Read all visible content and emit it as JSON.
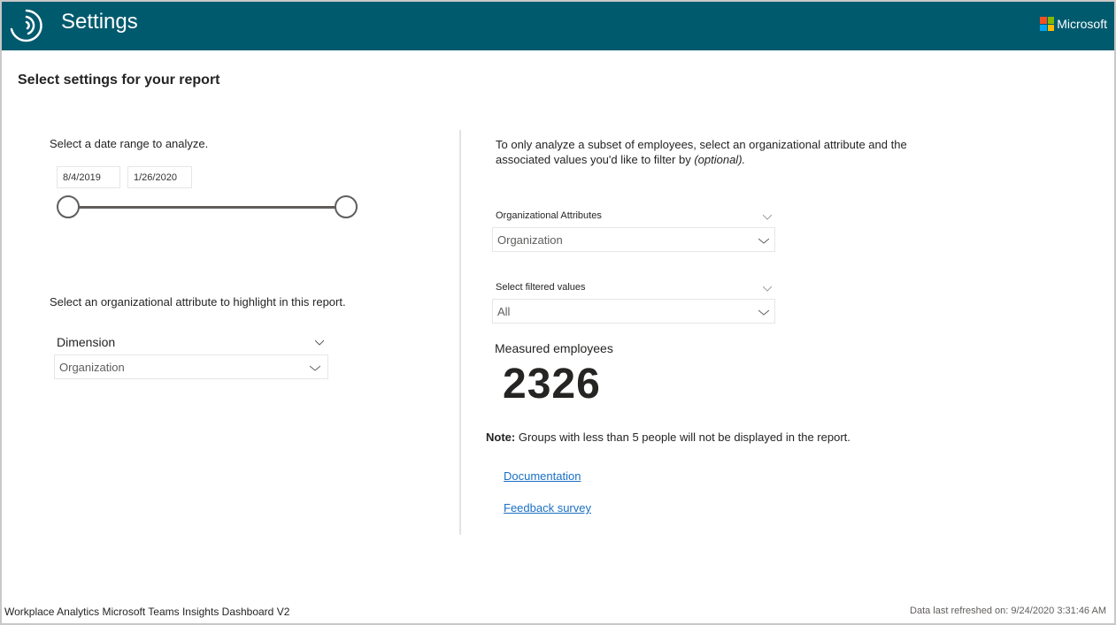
{
  "header": {
    "title": "Settings",
    "brand": "Microsoft",
    "brand_colors": [
      "#f25022",
      "#7fba00",
      "#00a4ef",
      "#ffb900"
    ],
    "background_color": "#005a6e"
  },
  "page": {
    "title": "Select settings for your report"
  },
  "left": {
    "date_range": {
      "label": "Select a date range to analyze.",
      "start": "8/4/2019",
      "end": "1/26/2020"
    },
    "highlight": {
      "label": "Select an organizational attribute to highlight in this report.",
      "dropdown_header": "Dimension",
      "selected": "Organization"
    }
  },
  "right": {
    "intro_text": "To only analyze a subset of employees, select an organizational attribute and the associated values you'd like to filter by ",
    "intro_italic": "(optional).",
    "org_attributes": {
      "header": "Organizational Attributes",
      "selected": "Organization"
    },
    "filtered_values": {
      "header": "Select filtered values",
      "selected": "All"
    },
    "kpi": {
      "label": "Measured employees",
      "value": "2326"
    },
    "note_bold": "Note:",
    "note_text": " Groups with less than 5 people will not be displayed in the report.",
    "links": {
      "documentation": "Documentation",
      "feedback": "Feedback survey"
    }
  },
  "footer": {
    "report_name": "Workplace Analytics Microsoft Teams Insights Dashboard V2",
    "refresh_text": "Data last refreshed on: 9/24/2020 3:31:46 AM"
  }
}
